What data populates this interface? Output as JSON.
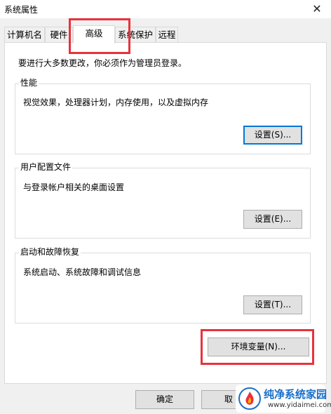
{
  "window": {
    "title": "系统属性",
    "close_label": "✕"
  },
  "tabs": [
    {
      "label": "计算机名"
    },
    {
      "label": "硬件"
    },
    {
      "label": "高级"
    },
    {
      "label": "系统保护"
    },
    {
      "label": "远程"
    }
  ],
  "advanced": {
    "admin_note": "要进行大多数更改，你必须作为管理员登录。",
    "performance": {
      "title": "性能",
      "description": "视觉效果，处理器计划，内存使用，以及虚拟内存",
      "button": "设置(S)..."
    },
    "user_profiles": {
      "title": "用户配置文件",
      "description": "与登录帐户相关的桌面设置",
      "button": "设置(E)..."
    },
    "startup_recovery": {
      "title": "启动和故障恢复",
      "description": "系统启动、系统故障和调试信息",
      "button": "设置(T)..."
    },
    "env_vars_button": "环境变量(N)..."
  },
  "footer": {
    "ok_button": "确定",
    "cancel_button_partial": "取"
  },
  "watermark": {
    "title": "纯净系统家园",
    "url": "www.yidaimei.com",
    "colors": {
      "brand": "#1a6fc8",
      "flame": "#e8323c"
    }
  },
  "highlight_color": "#e8323c"
}
